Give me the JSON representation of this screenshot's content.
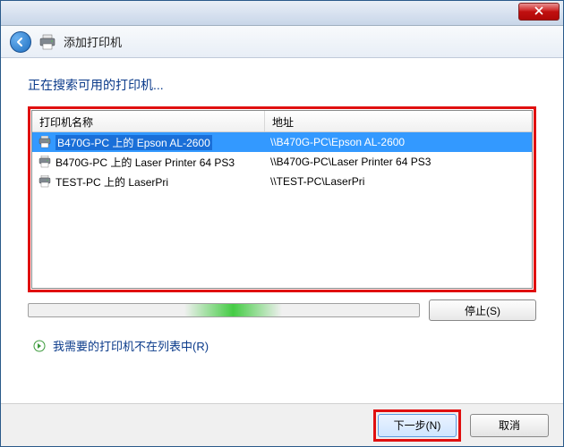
{
  "window": {
    "title": "添加打印机"
  },
  "content": {
    "searching_title": "正在搜索可用的打印机...",
    "columns": {
      "name": "打印机名称",
      "address": "地址"
    },
    "printers": [
      {
        "name": "B470G-PC 上的 Epson AL-2600",
        "address": "\\\\B470G-PC\\Epson AL-2600",
        "selected": true
      },
      {
        "name": "B470G-PC 上的 Laser Printer 64 PS3",
        "address": "\\\\B470G-PC\\Laser Printer 64 PS3",
        "selected": false
      },
      {
        "name": "TEST-PC 上的 LaserPri",
        "address": "\\\\TEST-PC\\LaserPri",
        "selected": false
      }
    ],
    "stop_label": "停止(S)",
    "not_listed_label": "我需要的打印机不在列表中(R)"
  },
  "footer": {
    "next_label": "下一步(N)",
    "cancel_label": "取消"
  },
  "highlights": {
    "color": "#e01010"
  }
}
